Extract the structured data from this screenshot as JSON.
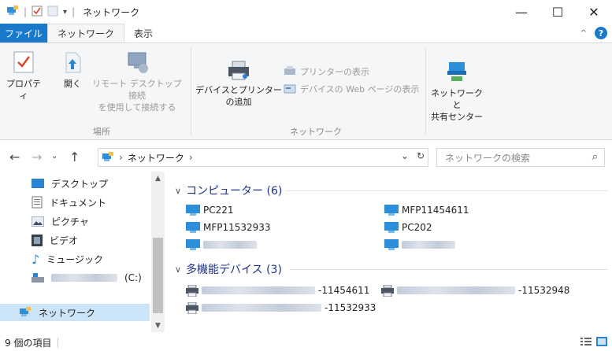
{
  "window": {
    "title": "ネットワーク",
    "minimize_glyph": "—",
    "maximize_glyph": "☐",
    "close_glyph": "✕"
  },
  "tabs": {
    "file": "ファイル",
    "network": "ネットワーク",
    "view": "表示"
  },
  "ribbon": {
    "properties": "プロパティ",
    "open": "開く",
    "remote_line1": "リモート デスクトップ接続",
    "remote_line2": "を使用して接続する",
    "group_location": "場所",
    "add_devices_line1": "デバイスとプリンター",
    "add_devices_line2": "の追加",
    "show_printers": "プリンターの表示",
    "show_device_web": "デバイスの Web ページの表示",
    "group_network": "ネットワーク",
    "sharing_center_line1": "ネットワークと",
    "sharing_center_line2": "共有センター"
  },
  "address": {
    "path": "ネットワーク",
    "search_placeholder": "ネットワークの検索"
  },
  "sidebar": {
    "items": [
      {
        "label": "デスクトップ"
      },
      {
        "label": "ドキュメント"
      },
      {
        "label": "ピクチャ"
      },
      {
        "label": "ビデオ"
      },
      {
        "label": "ミュージック"
      },
      {
        "label": "(C:)"
      },
      {
        "label": "ネットワーク"
      }
    ]
  },
  "content": {
    "computers_header": "コンピューター (6)",
    "computers": [
      "PC221",
      "MFP11454611",
      "MFP11532933",
      "PC202"
    ],
    "devices_header": "多機能デバイス (3)",
    "devices": [
      "-11454611",
      "-11532948",
      "-11532933"
    ]
  },
  "status": {
    "item_count": "9 個の項目"
  },
  "colors": {
    "accent": "#1979ca",
    "group_header": "#1e3287",
    "selection": "#cce4f7"
  }
}
